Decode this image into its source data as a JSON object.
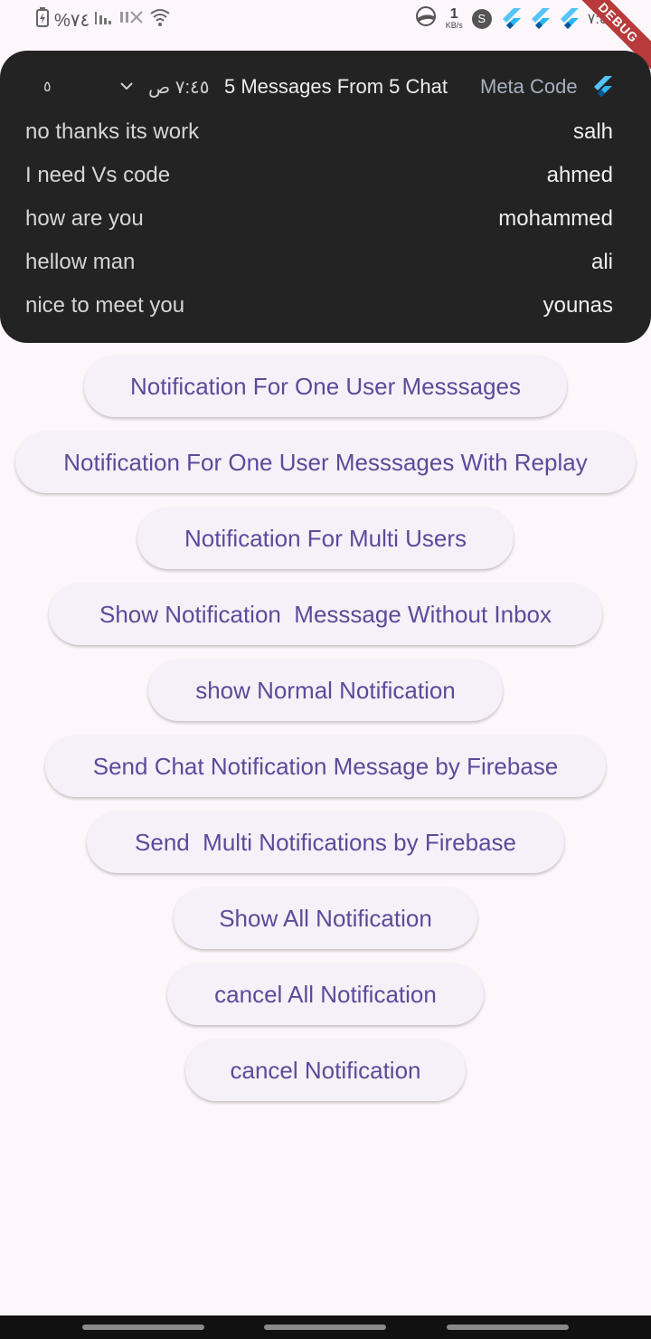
{
  "status_bar": {
    "battery_percent": "%٧٤",
    "network_speed_value": "1",
    "network_speed_unit": "KB/s",
    "s_badge": "S",
    "time": "٧:٤٥"
  },
  "debug_banner": "DEBUG",
  "notification": {
    "count": "٥",
    "time": "٧:٤٥ ص",
    "title": "5 Messages From 5 Chat",
    "app_name": "Meta Code",
    "messages": [
      {
        "text": "no thanks its work",
        "sender": "salh"
      },
      {
        "text": "I need Vs code",
        "sender": "ahmed"
      },
      {
        "text": "how are you",
        "sender": "mohammed"
      },
      {
        "text": "hellow man",
        "sender": "ali"
      },
      {
        "text": "nice to meet you",
        "sender": "younas"
      }
    ]
  },
  "buttons": [
    {
      "label": "Notification For One User Messsages"
    },
    {
      "label": "Notification For One User Messsages With Replay"
    },
    {
      "label": "Notification For Multi Users"
    },
    {
      "label": "Show Notification  Messsage Without Inbox"
    },
    {
      "label": "show Normal Notification"
    },
    {
      "label": "Send Chat Notification Message by Firebase"
    },
    {
      "label": "Send  Multi Notifications by Firebase"
    },
    {
      "label": "Show All Notification"
    },
    {
      "label": "cancel All Notification"
    },
    {
      "label": "cancel Notification"
    }
  ],
  "icons": {
    "battery": "battery-charging-icon",
    "signal": "signal-icon",
    "wifi": "wifi-icon",
    "app_logo": "flutter-icon",
    "expand": "chevron-down-icon"
  },
  "colors": {
    "button_text": "#5d4a9a",
    "button_bg": "#f6f1f8",
    "notification_bg": "#232323",
    "debug_banner": "#b83a3a"
  }
}
